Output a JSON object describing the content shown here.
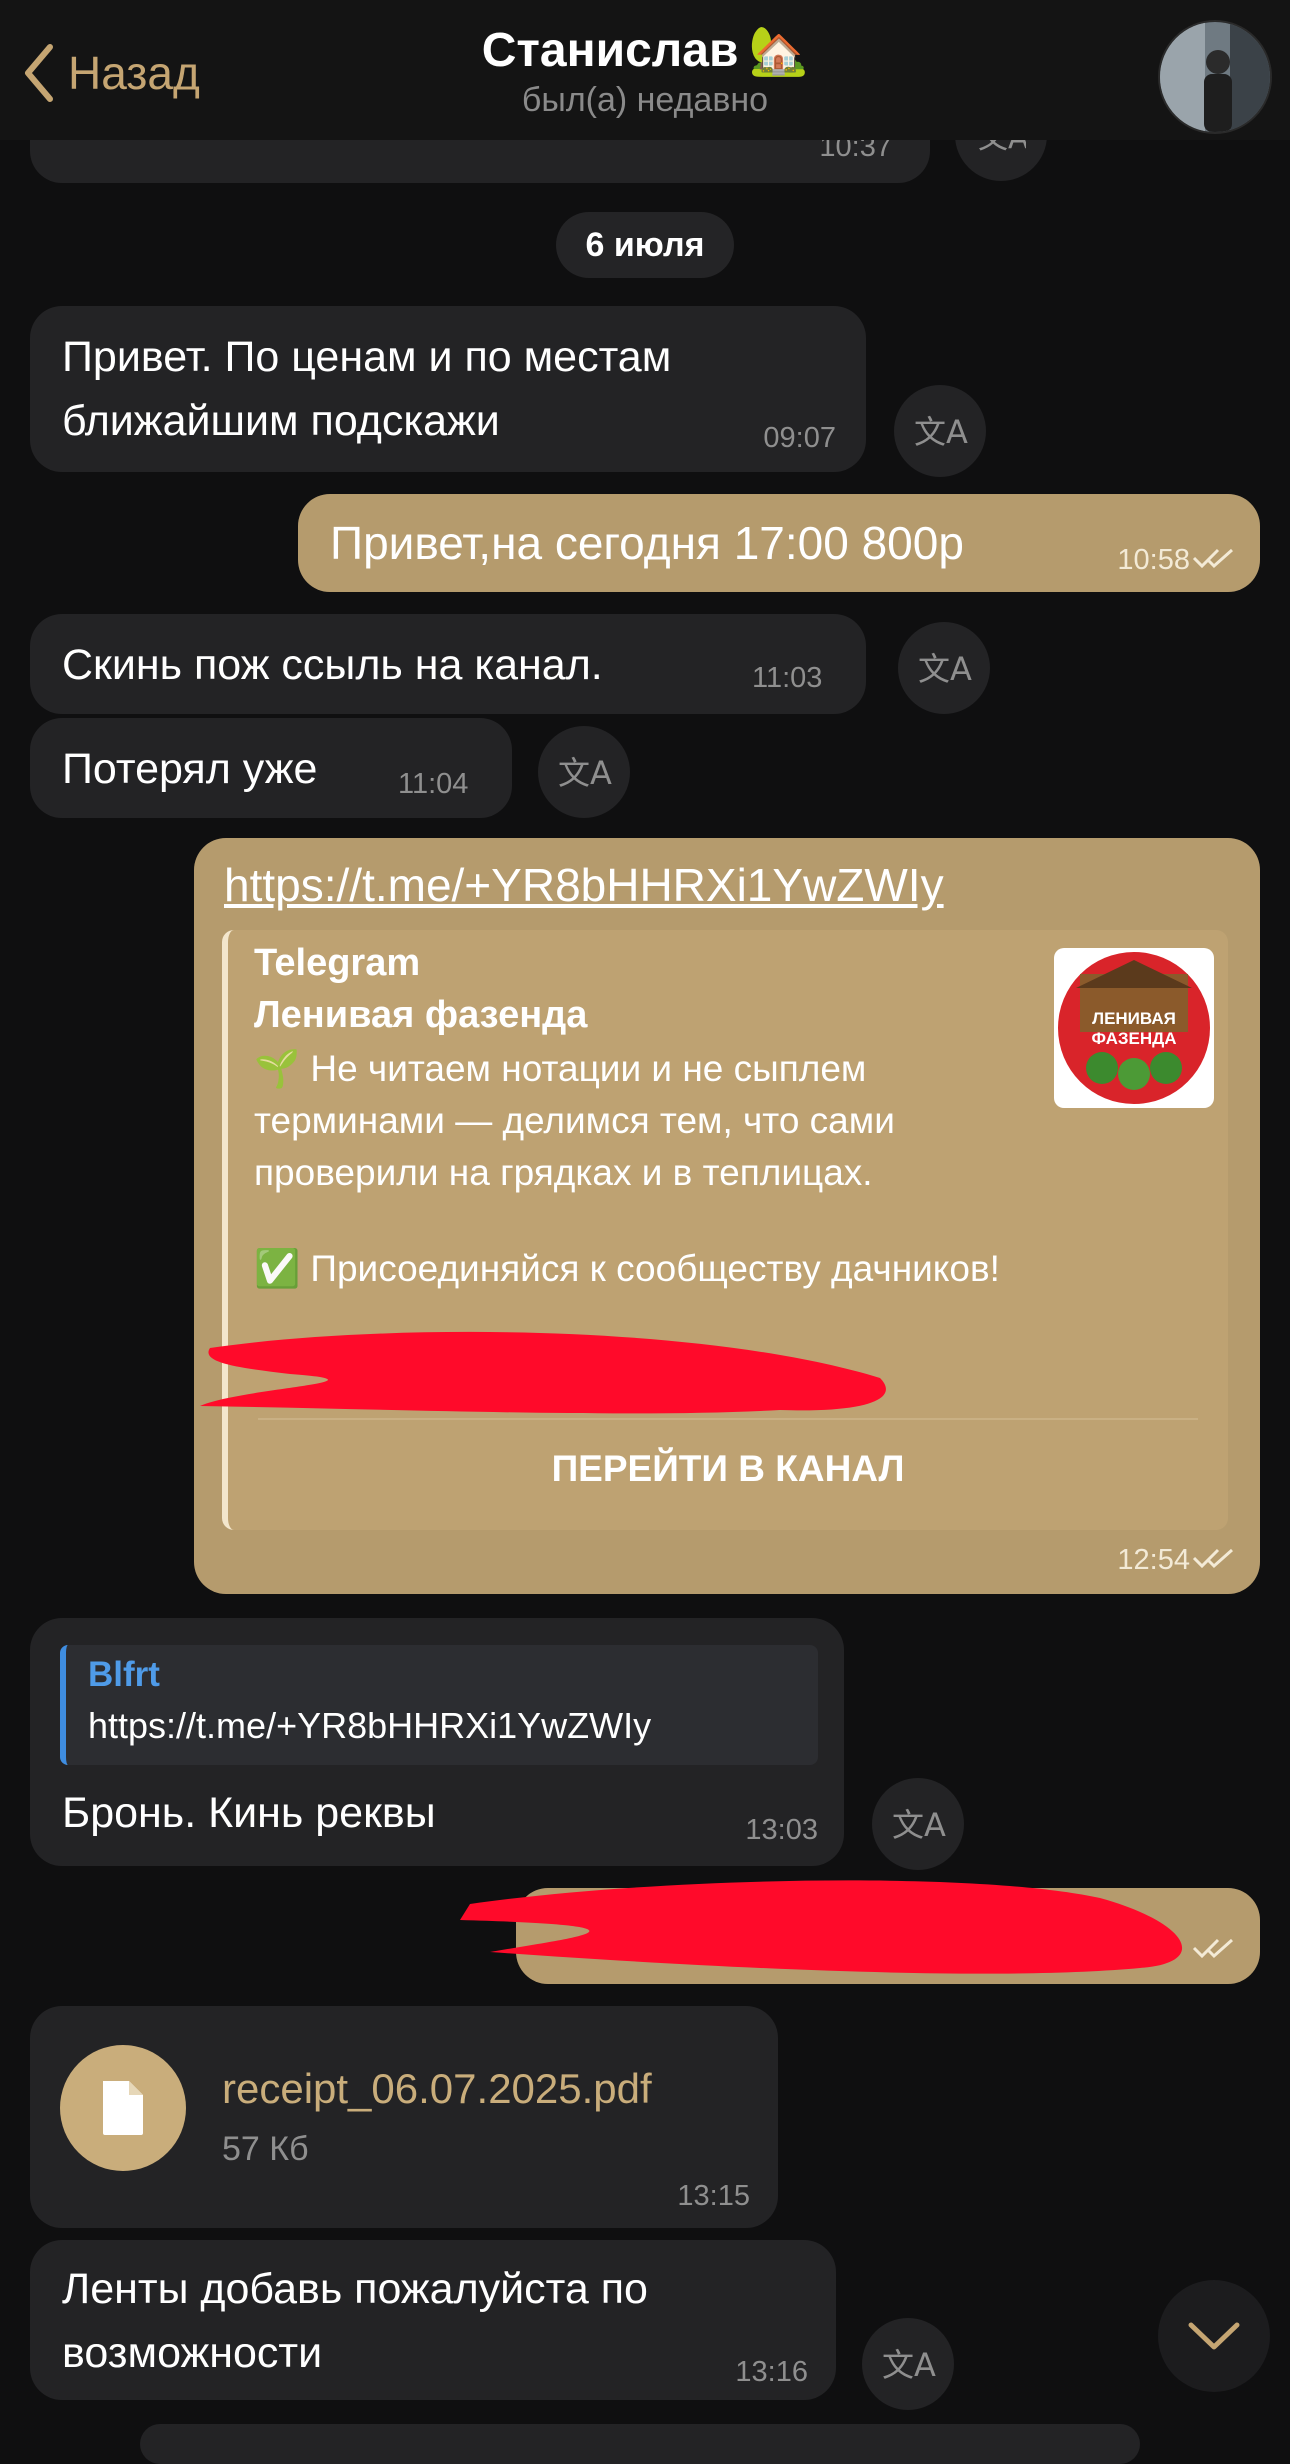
{
  "header": {
    "back_label": "Назад",
    "title": "Станислав",
    "title_emoji": "🏡",
    "subtitle": "был(а) недавно"
  },
  "date_separator": "6 июля",
  "cropped_message": {
    "time": "10:37"
  },
  "messages": [
    {
      "direction": "in",
      "lines": [
        "Привет. По ценам и по местам",
        "ближайшим подскажи"
      ],
      "time": "09:07"
    },
    {
      "direction": "out",
      "text": "Привет,на сегодня 17:00 800р",
      "time": "10:58"
    },
    {
      "direction": "in",
      "text": "Скинь пож ссыль на канал.",
      "time": "11:03"
    },
    {
      "direction": "in",
      "text": "Потерял уже",
      "time": "11:04"
    },
    {
      "direction": "out",
      "link": "https://t.me/+YR8bHHRXi1YwZWIy",
      "preview": {
        "site": "Telegram",
        "channel": "Ленивая фазенда",
        "description": [
          "🌱 Не читаем нотации и не сыплем",
          "терминами — делимся тем, что сами",
          "проверили на грядках и в теплицах."
        ],
        "cta_line": "✅ Присоединяйся к сообществу дачников!",
        "logo_text": [
          "ЛЕНИВАЯ",
          "ФАЗЕНДА"
        ],
        "button": "ПЕРЕЙТИ В КАНАЛ"
      },
      "time": "12:54"
    },
    {
      "direction": "in",
      "reply": {
        "author": "Blfrt",
        "text": "https://t.me/+YR8bHHRXi1YwZWIy"
      },
      "text": "Бронь. Кинь реквы",
      "time": "13:03"
    },
    {
      "direction": "out",
      "redacted": true
    },
    {
      "direction": "in",
      "file": {
        "name": "receipt_06.07.2025.pdf",
        "size": "57 Кб"
      },
      "time": "13:15"
    },
    {
      "direction": "in",
      "lines": [
        "Ленты добавь пожалуйста по",
        "возможности"
      ],
      "time": "13:16"
    }
  ],
  "colors": {
    "background": "#0f0f10",
    "incoming": "#232325",
    "outgoing": "#b59b6d",
    "accent": "#c5a572",
    "redaction": "#ff0a2a"
  },
  "icons": [
    "chevron-left-icon",
    "translate-icon",
    "double-check-icon",
    "document-icon",
    "chevron-down-icon"
  ]
}
